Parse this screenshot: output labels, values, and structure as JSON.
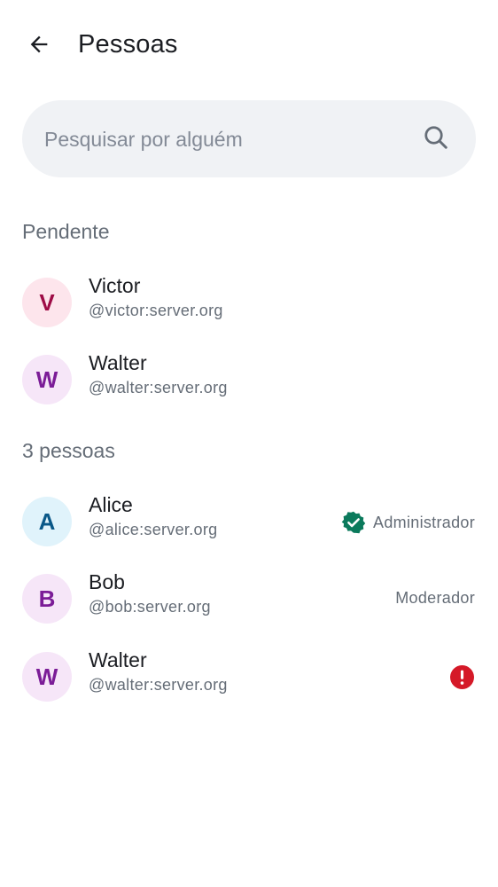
{
  "header": {
    "title": "Pessoas",
    "back_icon": "arrow-left-icon"
  },
  "search": {
    "placeholder": "Pesquisar por alguém",
    "value": "",
    "icon": "search-icon"
  },
  "pending": {
    "header": "Pendente",
    "members": [
      {
        "initial": "V",
        "name": "Victor",
        "handle": "@victor:server.org",
        "avatar_bg": "#fde5ec",
        "avatar_fg": "#9e0c46"
      },
      {
        "initial": "W",
        "name": "Walter",
        "handle": "@walter:server.org",
        "avatar_bg": "#f6e6f8",
        "avatar_fg": "#7b1c97"
      }
    ]
  },
  "joined": {
    "header": "3 pessoas",
    "members": [
      {
        "initial": "A",
        "name": "Alice",
        "handle": "@alice:server.org",
        "role": "Administrador",
        "role_icon": "verified-badge-icon",
        "avatar_bg": "#e0f3fb",
        "avatar_fg": "#0a5888"
      },
      {
        "initial": "B",
        "name": "Bob",
        "handle": "@bob:server.org",
        "role": "Moderador",
        "avatar_bg": "#f6e6f8",
        "avatar_fg": "#7b1c97"
      },
      {
        "initial": "W",
        "name": "Walter",
        "handle": "@walter:server.org",
        "status_icon": "error-icon",
        "avatar_bg": "#f6e6f8",
        "avatar_fg": "#7b1c97"
      }
    ]
  },
  "colors": {
    "verified": "#0b7a5c",
    "error": "#d51928",
    "secondary_text": "#656d77",
    "search_bg": "#f0f2f5"
  }
}
